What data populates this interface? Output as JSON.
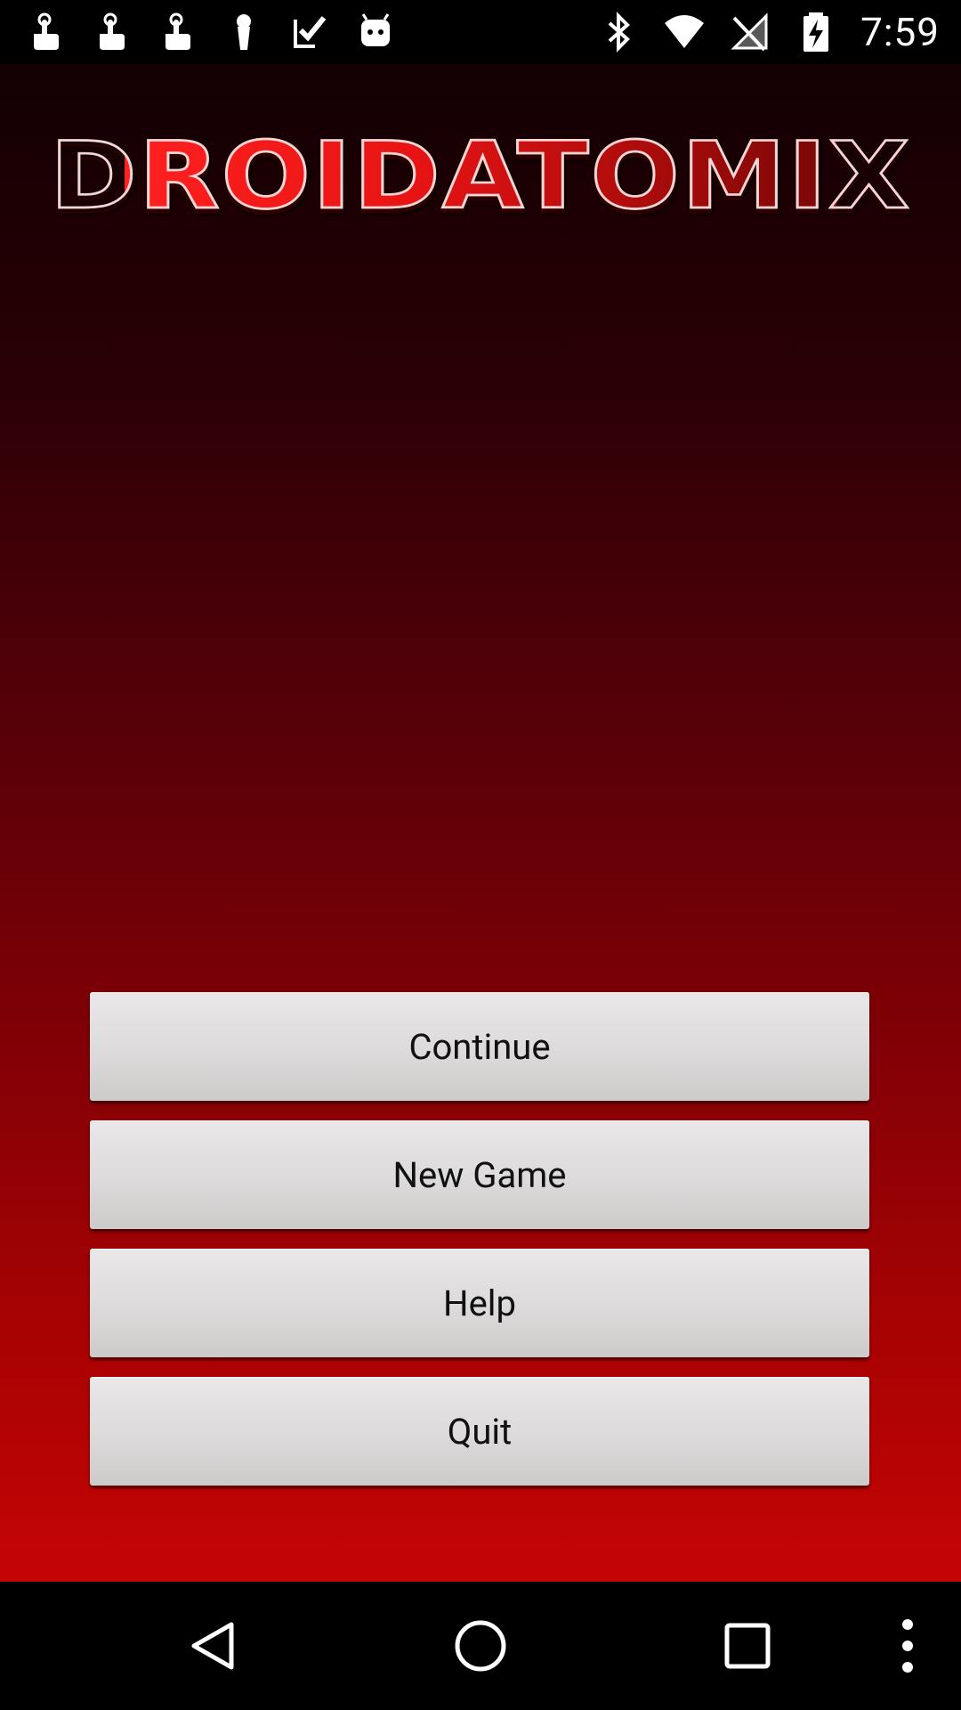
{
  "status_bar": {
    "time": "7:59",
    "left_icons": [
      "touch-icon",
      "touch-icon",
      "touch-icon",
      "keyhole-icon",
      "check-icon",
      "android-icon"
    ],
    "right_icons": [
      "bluetooth-icon",
      "wifi-icon",
      "no-signal-icon",
      "battery-charging-icon"
    ]
  },
  "app": {
    "logo_text": "DROIDATOMIX",
    "buttons": {
      "continue": "Continue",
      "new_game": "New Game",
      "help": "Help",
      "quit": "Quit"
    }
  },
  "nav_bar": {
    "icons": [
      "back-icon",
      "home-icon",
      "recents-icon",
      "menu-overflow-icon"
    ]
  }
}
